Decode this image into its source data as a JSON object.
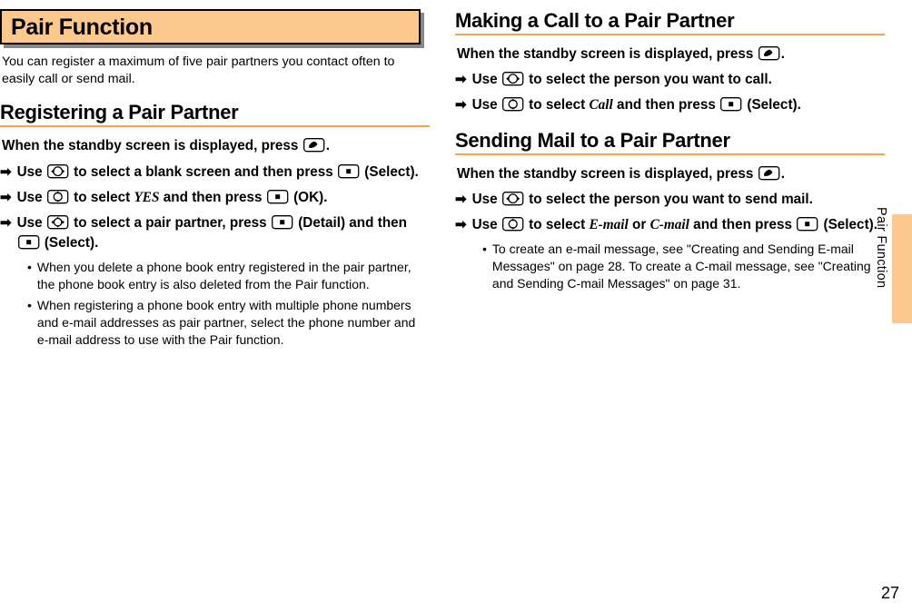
{
  "left": {
    "mainHeading": "Pair Function",
    "intro": "You can register a maximum of five pair partners you contact often to easily call or send mail.",
    "sub1": "Registering a Pair Partner",
    "standby_a": "When the standby screen is displayed, press ",
    "period": ".",
    "s1a": "Use ",
    "s1b": " to select a blank screen and then press ",
    "s1c": " (Select).",
    "s2a": "Use ",
    "s2b": " to select ",
    "s2yes": "YES",
    "s2c": " and then press ",
    "s2d": " (OK).",
    "s3a": "Use ",
    "s3b": " to select a pair partner, press ",
    "s3c": " (Detail) and then ",
    "s3d": " (Select).",
    "b1": "When you delete a phone book entry registered in the pair partner, the phone book entry is also deleted from the Pair function.",
    "b2": "When registering a phone book entry with multiple phone numbers and e-mail addresses as pair partner, select the phone number and e-mail address to use with the Pair function."
  },
  "right": {
    "sub2": "Making a Call to a Pair Partner",
    "standby_b": "When the standby screen is displayed, press ",
    "r1a": "Use ",
    "r1b": " to select the person you want to call.",
    "r2a": "Use ",
    "r2b": " to select ",
    "r2call": "Call",
    "r2c": " and then press ",
    "r2d": " (Select).",
    "sub3": "Sending Mail to a Pair Partner",
    "standby_c": "When the standby screen is displayed, press ",
    "r3a": "Use ",
    "r3b": " to select the person you want to send mail.",
    "r4a": "Use ",
    "r4b": " to select ",
    "r4e": "E-mail",
    "r4or": " or ",
    "r4c": "C-mail",
    "r4d": " and then press ",
    "r4f": " (Select).",
    "b3": "To create an e-mail message, see \"Creating and Sending E-mail Messages\" on page 28. To create a C-mail message, see \"Creating and Sending C-mail Messages\" on page 31."
  },
  "side": "Pair Function",
  "pageNum": "27"
}
